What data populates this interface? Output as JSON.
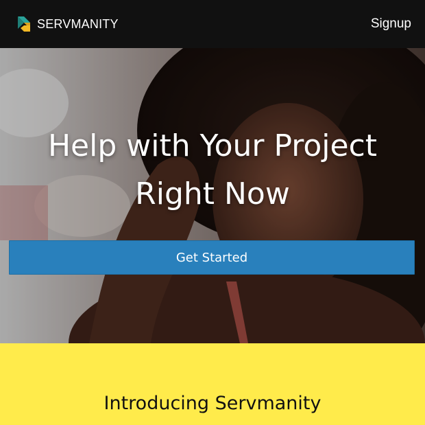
{
  "header": {
    "brand_name": "SERVMANITY",
    "signup_label": "Signup",
    "background_color": "#111111"
  },
  "hero": {
    "title_line1": "Help with Your Project",
    "title_line2": "Right Now",
    "cta_label": "Get Started",
    "cta_color": "#2980bc"
  },
  "intro": {
    "title": "Introducing Servmanity",
    "background_color": "#ffeb4b"
  },
  "icons": {
    "logo": "servmanity-logo-icon"
  }
}
